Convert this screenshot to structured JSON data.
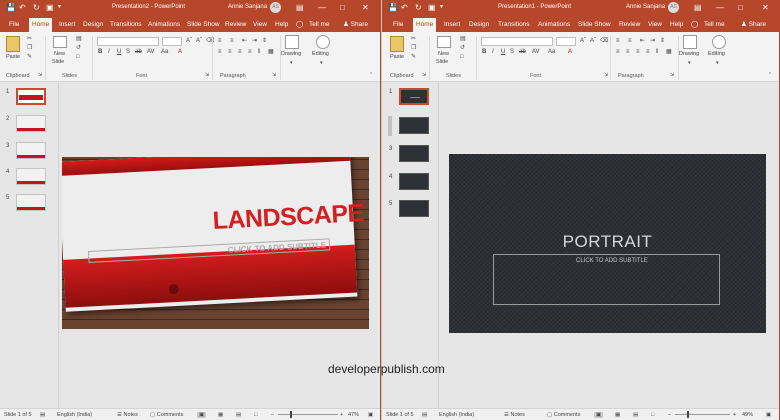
{
  "left": {
    "title": "Presentation2 - PowerPoint",
    "user": "Annie Sanjana",
    "user_initials": "AS",
    "tabs": [
      "File",
      "Home",
      "Insert",
      "Design",
      "Transitions",
      "Animations",
      "Slide Show",
      "Review",
      "View",
      "Help"
    ],
    "tell_me": "Tell me",
    "share": "Share",
    "ribbon": {
      "paste": "Paste",
      "new_slide_1": "New",
      "new_slide_2": "Slide",
      "drawing": "Drawing",
      "editing": "Editing",
      "groups": {
        "clipboard": "Clipboard",
        "slides": "Slides",
        "font": "Font",
        "paragraph": "Paragraph"
      }
    },
    "slide_numbers": [
      "1",
      "2",
      "3",
      "4",
      "5"
    ],
    "slide": {
      "title": "LANDSCAPE",
      "subtitle": "CLICK TO ADD SUBTITLE"
    },
    "status": {
      "slide": "Slide 1 of 5",
      "language": "English (India)",
      "notes": "Notes",
      "comments": "Comments",
      "zoom": "47%"
    },
    "zoom_value": 47
  },
  "right": {
    "title": "Presentation1 - PowerPoint",
    "user": "Annie Sanjana",
    "user_initials": "AS",
    "tabs": [
      "File",
      "Home",
      "Insert",
      "Design",
      "Transitions",
      "Animations",
      "Slide Show",
      "Review",
      "View",
      "Help"
    ],
    "tell_me": "Tell me",
    "share": "Share",
    "ribbon": {
      "paste": "Paste",
      "new_slide_1": "New",
      "new_slide_2": "Slide",
      "drawing": "Drawing",
      "editing": "Editing",
      "groups": {
        "clipboard": "Clipboard",
        "slides": "Slides",
        "font": "Font",
        "paragraph": "Paragraph"
      }
    },
    "slide_numbers": [
      "1",
      "2",
      "3",
      "4",
      "5"
    ],
    "slide": {
      "title": "PORTRAIT",
      "subtitle": "CLICK TO ADD SUBTITLE"
    },
    "status": {
      "slide": "Slide 1 of 5",
      "language": "English (India)",
      "notes": "Notes",
      "comments": "Comments",
      "zoom": "49%"
    },
    "zoom_value": 49
  },
  "watermark": "developerpublish.com",
  "colors": {
    "accent": "#b7472a",
    "selected_thumb": "#d24726",
    "landscape_red": "#c0161c",
    "portrait_bg": "#2d3035"
  }
}
